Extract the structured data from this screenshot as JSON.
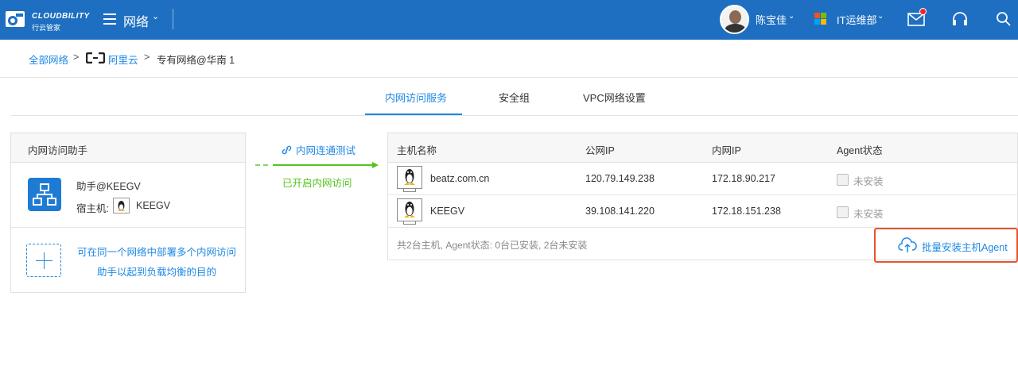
{
  "topbar": {
    "brand": "CLOUDBILITY",
    "brand_sub": "行云管家",
    "menu_label": "网络",
    "user_name": "陈宝佳",
    "department": "IT运维部",
    "chevron": "⌄",
    "colors": {
      "bar": "#1e6fc1",
      "badge": "#f5222d"
    }
  },
  "breadcrumb": {
    "root": "全部网络",
    "provider": "阿里云",
    "current": "专有网络@华南 1",
    "sep": ">"
  },
  "tabs": [
    {
      "label": "内网访问服务",
      "active": true
    },
    {
      "label": "安全组",
      "active": false
    },
    {
      "label": "VPC网络设置",
      "active": false
    }
  ],
  "assistant_panel": {
    "title": "内网访问助手",
    "assistant_name": "助手@KEEGV",
    "host_label": "宿主机:",
    "host_name": "KEEGV",
    "hint_line1": "可在同一个网络中部署多个内网访问",
    "hint_line2": "助手以起到负载均衡的目的"
  },
  "connector": {
    "test_label": "内网连通测试",
    "enabled_label": "已开启内网访问"
  },
  "hosts_table": {
    "columns": [
      "主机名称",
      "公网IP",
      "内网IP",
      "Agent状态"
    ],
    "rows": [
      {
        "name": "beatz.com.cn",
        "public_ip": "120.79.149.238",
        "private_ip": "172.18.90.217",
        "agent": "未安装"
      },
      {
        "name": "KEEGV",
        "public_ip": "39.108.141.220",
        "private_ip": "172.18.151.238",
        "agent": "未安装"
      }
    ],
    "summary": "共2台主机, Agent状态: 0台已安装, 2台未安装",
    "batch_install": "批量安装主机Agent"
  }
}
